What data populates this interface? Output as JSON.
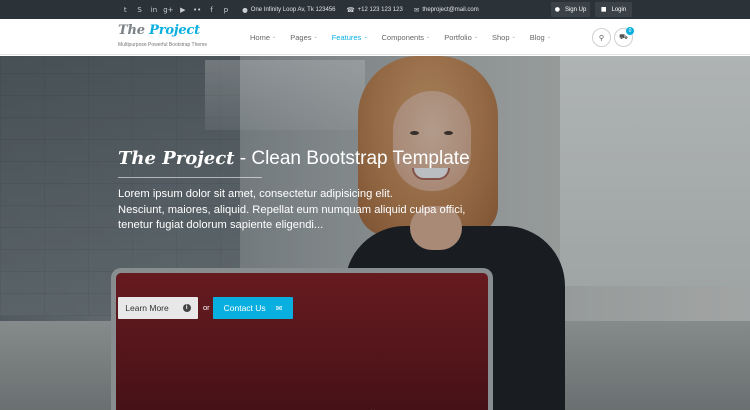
{
  "topbar": {
    "socials": [
      {
        "icon": "twitter-icon",
        "glyph": "t"
      },
      {
        "icon": "skype-icon",
        "glyph": "S"
      },
      {
        "icon": "linkedin-icon",
        "glyph": "in"
      },
      {
        "icon": "google-plus-icon",
        "glyph": "g+"
      },
      {
        "icon": "youtube-icon",
        "glyph": "▶"
      },
      {
        "icon": "flickr-icon",
        "glyph": "••"
      },
      {
        "icon": "facebook-icon",
        "glyph": "f"
      },
      {
        "icon": "pinterest-icon",
        "glyph": "p"
      }
    ],
    "address": "One Infinity Loop Av, Tk 123456",
    "phone": "+12 123 123 123",
    "email": "theproject@mail.com",
    "signup_label": "Sign Up",
    "login_label": "Login"
  },
  "header": {
    "logo_the": "The",
    "logo_project": " Project",
    "tagline": "Multipurpose Powerful Bootstrap Theme",
    "nav": [
      "Home",
      "Pages",
      "Features",
      "Components",
      "Portfolio",
      "Shop",
      "Blog"
    ],
    "active_nav": "Features",
    "cart_count": "0"
  },
  "hero": {
    "brand": "The Project",
    "title_rest": " - Clean Bootstrap Template",
    "lines": [
      "Lorem ipsum dolor sit amet, consectetur adipisicing elit.",
      "Nesciunt, maiores, aliquid. Repellat eum numquam aliquid culpa offici,",
      "tenetur fugiat dolorum sapiente eligendi..."
    ],
    "learn_more_label": "Learn More",
    "or_label": "or",
    "contact_label": "Contact Us"
  },
  "colors": {
    "accent": "#09afdf",
    "topbar_bg": "#2b3338"
  }
}
